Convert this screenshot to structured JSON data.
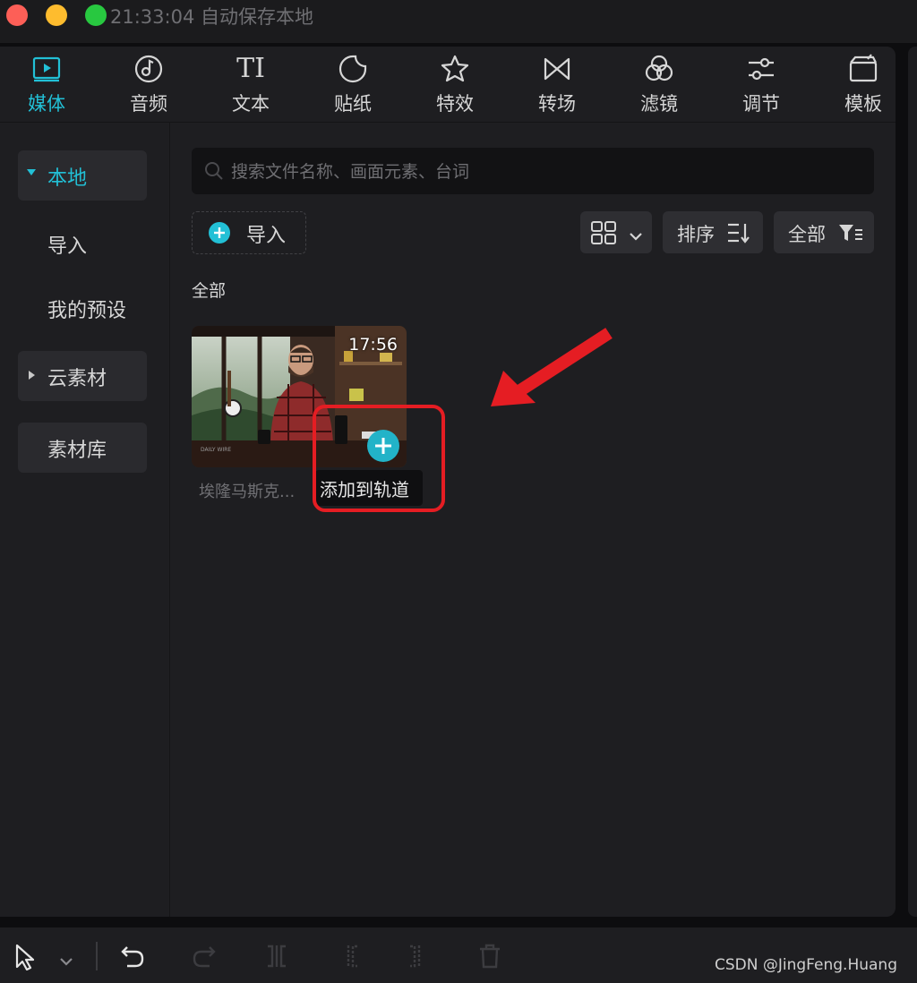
{
  "titlebar": {
    "text": "21:33:04 自动保存本地"
  },
  "tabs": [
    {
      "label": "媒体",
      "icon": "media-icon",
      "active": true
    },
    {
      "label": "音频",
      "icon": "audio-icon"
    },
    {
      "label": "文本",
      "icon": "text-icon",
      "glyph": "TI"
    },
    {
      "label": "贴纸",
      "icon": "sticker-icon"
    },
    {
      "label": "特效",
      "icon": "effects-icon"
    },
    {
      "label": "转场",
      "icon": "transition-icon"
    },
    {
      "label": "滤镜",
      "icon": "filter-icon"
    },
    {
      "label": "调节",
      "icon": "adjust-icon"
    },
    {
      "label": "模板",
      "icon": "template-icon"
    }
  ],
  "sidebar": {
    "items": [
      {
        "label": "本地",
        "active": true
      },
      {
        "label": "导入"
      },
      {
        "label": "我的预设"
      },
      {
        "label": "云素材"
      },
      {
        "label": "素材库"
      }
    ]
  },
  "search": {
    "placeholder": "搜索文件名称、画面元素、台词"
  },
  "toolbar": {
    "import_label": "导入",
    "sort_label": "排序",
    "filter_label": "全部"
  },
  "section": {
    "label": "全部"
  },
  "media": {
    "duration": "17:56",
    "name": "埃隆马斯克...",
    "add_tooltip": "添加到轨道"
  },
  "watermark": {
    "text": "CSDN @JingFeng.Huang"
  },
  "colors": {
    "accent": "#22c0d6",
    "highlight": "#e51d23"
  }
}
